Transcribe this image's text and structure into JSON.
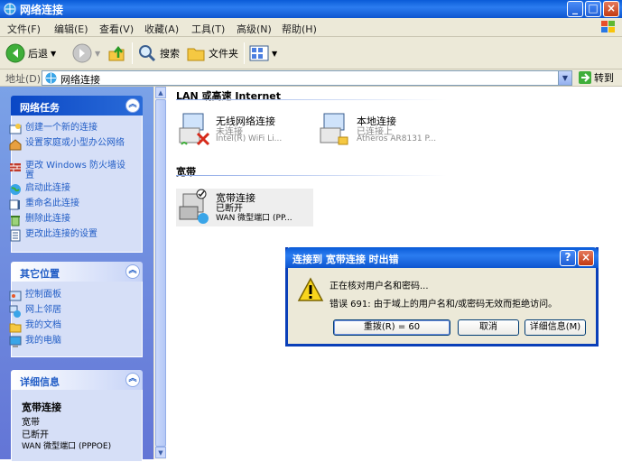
{
  "window": {
    "title": "网络连接"
  },
  "menu": [
    "文件(F)",
    "编辑(E)",
    "查看(V)",
    "收藏(A)",
    "工具(T)",
    "高级(N)",
    "帮助(H)"
  ],
  "toolbar": {
    "back": "后退",
    "search": "搜索",
    "folders": "文件夹"
  },
  "address": {
    "label": "地址(D)",
    "value": "网络连接",
    "go": "转到"
  },
  "tasks": {
    "title": "网络任务",
    "items": [
      "创建一个新的连接",
      "设置家庭或小型办公网络",
      "更改 Windows 防火墙设置",
      "启动此连接",
      "重命名此连接",
      "删除此连接",
      "更改此连接的设置"
    ]
  },
  "other_places": {
    "title": "其它位置",
    "items": [
      "控制面板",
      "网上邻居",
      "我的文档",
      "我的电脑"
    ]
  },
  "details": {
    "title": "详细信息",
    "name": "宽带连接",
    "type": "宽带",
    "status": "已断开",
    "device": "WAN 微型端口 (PPPOE)"
  },
  "groups": {
    "lan": "LAN 或高速 Internet",
    "broadband": "宽带"
  },
  "connections": [
    {
      "name": "无线网络连接",
      "status": "未连接",
      "device": "Intel(R) WiFi Li..."
    },
    {
      "name": "本地连接",
      "status": "已连接上",
      "device": "Atheros AR8131 P..."
    },
    {
      "name": "宽带连接",
      "status": "已断开",
      "device": "WAN 微型端口 (PP..."
    }
  ],
  "dialog": {
    "title": "连接到 宽带连接 时出错",
    "line1": "正在核对用户名和密码...",
    "line2": "错误 691: 由于域上的用户名和/或密码无效而拒绝访问。",
    "redial": "重拨(R) = 60",
    "cancel": "取消",
    "more": "详细信息(M)"
  },
  "colors": {
    "xp_blue": "#0a5bd8",
    "task_pane": "#6375d6",
    "link": "#215dc6"
  }
}
